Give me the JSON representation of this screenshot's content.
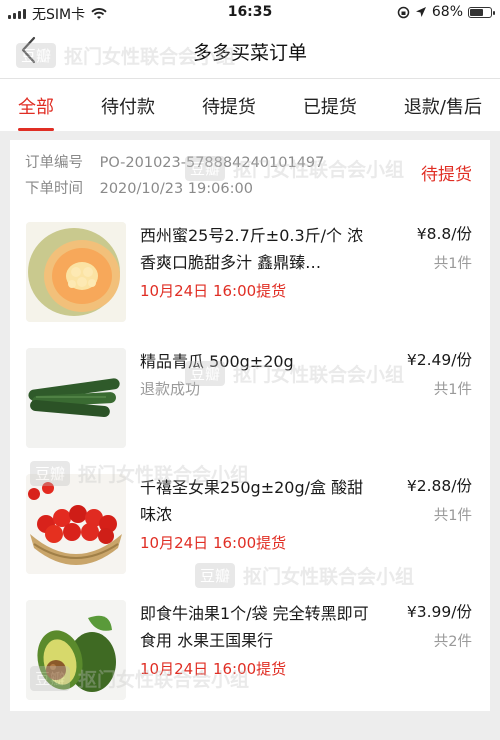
{
  "status_bar": {
    "carrier": "无SIM卡",
    "time": "16:35",
    "battery_percent": "68%",
    "battery_level": 0.68
  },
  "header": {
    "title": "多多买菜订单"
  },
  "tabs": [
    {
      "label": "全部",
      "active": true
    },
    {
      "label": "待付款",
      "active": false
    },
    {
      "label": "待提货",
      "active": false
    },
    {
      "label": "已提货",
      "active": false
    },
    {
      "label": "退款/售后",
      "active": false
    }
  ],
  "order": {
    "number_label": "订单编号",
    "number_value": "PO-201023-578884240101497",
    "time_label": "下单时间",
    "time_value": "2020/10/23 19:06:00",
    "status": "待提货",
    "items": [
      {
        "name": "西州蜜25号2.7斤±0.3斤/个 浓香爽口脆甜多汁 鑫鼎臻…",
        "price": "¥8.8/份",
        "qty": "共1件",
        "note": "10月24日 16:00提货",
        "note_type": "pickup",
        "image": "melon-image"
      },
      {
        "name": "精品青瓜 500g±20g",
        "price": "¥2.49/份",
        "qty": "共1件",
        "note": "退款成功",
        "note_type": "refund",
        "image": "cucumber-image"
      },
      {
        "name": "千禧圣女果250g±20g/盒 酸甜味浓",
        "price": "¥2.88/份",
        "qty": "共1件",
        "note": "10月24日 16:00提货",
        "note_type": "pickup",
        "image": "tomato-image"
      },
      {
        "name": "即食牛油果1个/袋 完全转黑即可食用 水果王国果行",
        "price": "¥3.99/份",
        "qty": "共2件",
        "note": "10月24日 16:00提货",
        "note_type": "pickup",
        "image": "avocado-image"
      }
    ]
  },
  "watermark": {
    "badge": "豆瓣",
    "text": "抠门女性联合会小组"
  },
  "colors": {
    "accent": "#e02e24",
    "background": "#ededed",
    "card": "#ffffff"
  }
}
